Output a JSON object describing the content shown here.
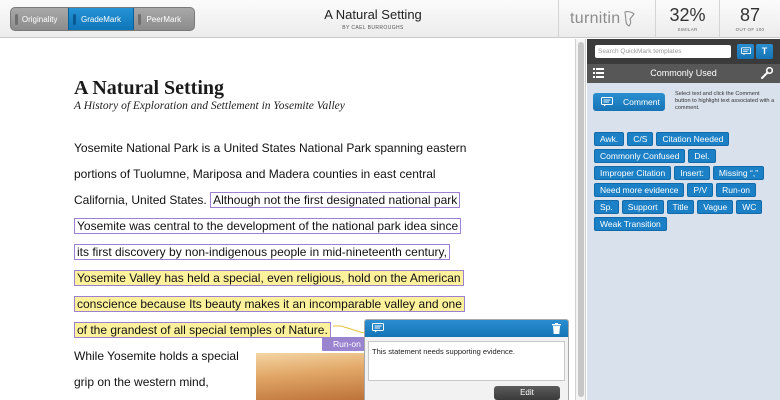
{
  "modes": {
    "items": [
      {
        "label": "Originality"
      },
      {
        "label": "GradeMark"
      },
      {
        "label": "PeerMark"
      }
    ],
    "selected": "GradeMark"
  },
  "header": {
    "title": "A Natural Setting",
    "author": "BY CAEL BURROUGHS",
    "logo": "turnitin",
    "similarity": {
      "value": "32%",
      "label": "SIMILAR"
    },
    "score": {
      "value": "87",
      "label": "OUT OF 100"
    }
  },
  "document": {
    "heading": "A Natural Setting",
    "subheading": "A History of Exploration and Settlement in Yosemite Valley",
    "p1": {
      "l1": "Yosemite National Park is a United States National Park spanning eastern",
      "l2": "portions of Tuolumne, Mariposa and Madera counties in east central",
      "l3a": "California, United States.",
      "l3b": "Although not the first designated national park",
      "l4": "Yosemite was central to the development of the national park idea since",
      "l5": "its first discovery by non-indigenous people in mid-nineteenth century,",
      "l6": "Yosemite Valley has held a special, even religious, hold on the American",
      "l7": "conscience because Its beauty makes it an incomparable valley and one",
      "l8": "of the grandest of all special temples of Nature."
    },
    "p2": {
      "l1": "While Yosemite holds a special",
      "l2": "grip on the western mind,"
    },
    "quickmark_tag": "Run-on"
  },
  "comment_popup": {
    "text": "This statement needs supporting evidence.",
    "edit_label": "Edit",
    "icons": [
      "comment-icon",
      "trash-icon"
    ]
  },
  "panel": {
    "search_placeholder": "Search QuickMark templates",
    "tool_buttons": [
      "comment-tool-icon",
      "T"
    ],
    "set_title": "Commonly Used",
    "comment_button": "Comment",
    "comment_help": "Select text and click the Comment button to highlight text associated with a comment.",
    "quickmarks": [
      "Awk.",
      "C/S",
      "Citation Needed",
      "Commonly Confused",
      "Del.",
      "Improper Citation",
      "Insert:",
      "Missing “,”",
      "Need more evidence",
      "P/V",
      "Run-on",
      "Sp.",
      "Support",
      "Title",
      "Vague",
      "WC",
      "Weak Transition"
    ]
  },
  "colors": {
    "accent_blue": "#1c80c6",
    "highlight_yellow": "#fdf29b",
    "highlight_border": "#9d7fd3",
    "panel_bg": "#d9e1ec"
  }
}
